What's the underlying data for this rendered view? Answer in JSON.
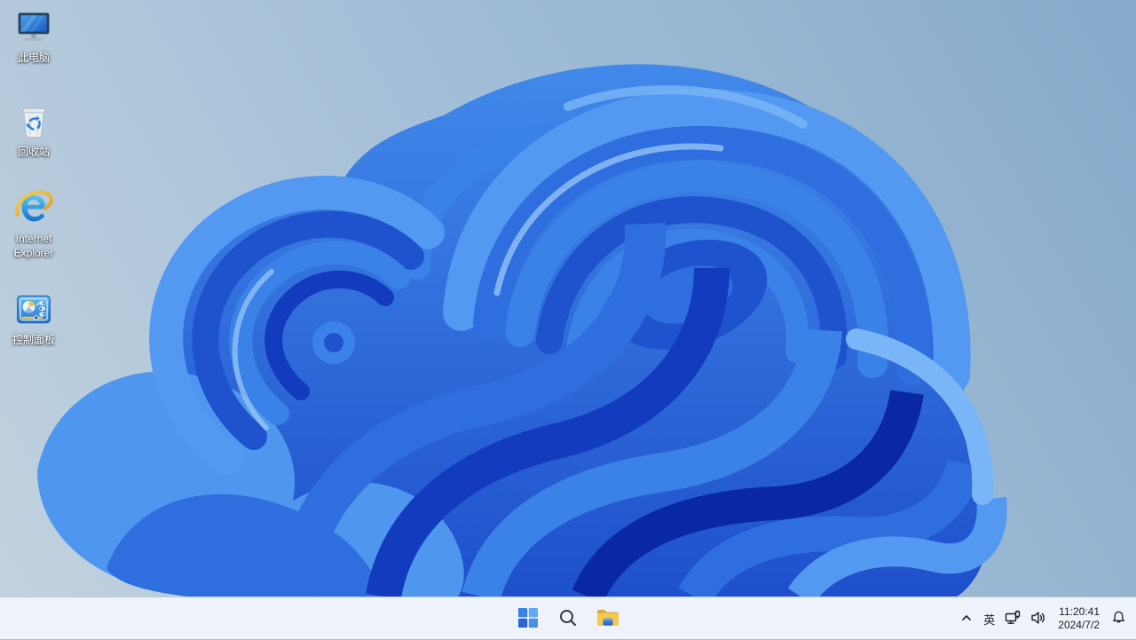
{
  "desktop": {
    "icons": [
      {
        "label": "此电脑"
      },
      {
        "label": "回收站"
      },
      {
        "label": "Internet Explorer"
      },
      {
        "label": "控制面板"
      }
    ]
  },
  "taskbar": {
    "tray": {
      "language": "英",
      "time": "11:20:41",
      "date": "2024/7/2"
    }
  },
  "colors": {
    "taskbar_bg": "#eef2f9",
    "sky_light": "#c4d4e0",
    "sky_deep": "#86abcb",
    "bloom_bright": "#5399f1",
    "bloom_mid": "#2e6ede",
    "bloom_deep": "#0a28a4",
    "tray_glyph": "#1b1f27"
  }
}
